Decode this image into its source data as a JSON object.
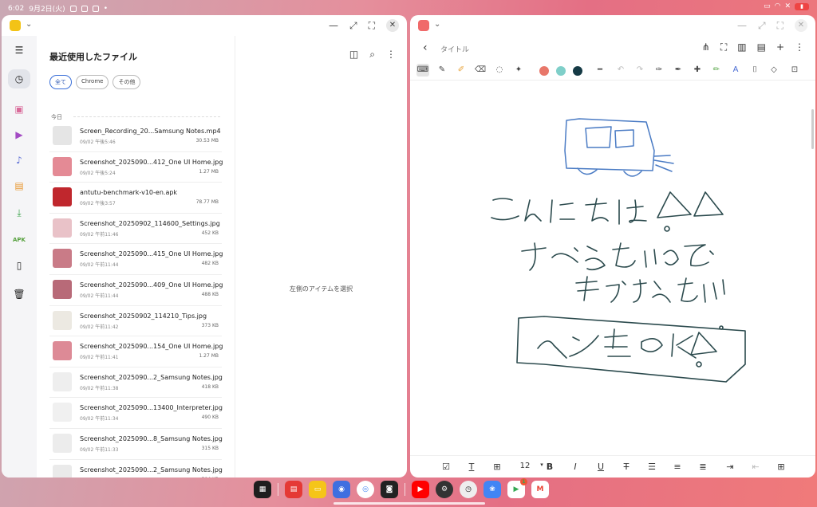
{
  "status_bar": {
    "time": "6:02",
    "date": "9月2日(火)"
  },
  "files_app": {
    "title": "最近使用したファイル",
    "filters": [
      "全て",
      "Chrome",
      "その他"
    ],
    "section": "今日",
    "empty_message": "左側のアイテムを選択",
    "rail_apk_label": "APK",
    "files": [
      {
        "name": "Screen_Recording_20...Samsung Notes.mp4",
        "date": "09/02 午後5:46",
        "size": "30.53 MB",
        "thumb": "#e5e5e5"
      },
      {
        "name": "Screenshot_2025090...412_One UI Home.jpg",
        "date": "09/02 午後5:24",
        "size": "1.27 MB",
        "thumb": "#e48a95"
      },
      {
        "name": "antutu-benchmark-v10-en.apk",
        "date": "09/02 午後3:57",
        "size": "78.77 MB",
        "thumb": "#c0272d"
      },
      {
        "name": "Screenshot_20250902_114600_Settings.jpg",
        "date": "09/02 午前11:46",
        "size": "452 KB",
        "thumb": "#e9c2c8"
      },
      {
        "name": "Screenshot_2025090...415_One UI Home.jpg",
        "date": "09/02 午前11:44",
        "size": "482 KB",
        "thumb": "#c97b87"
      },
      {
        "name": "Screenshot_2025090...409_One UI Home.jpg",
        "date": "09/02 午前11:44",
        "size": "488 KB",
        "thumb": "#b86a78"
      },
      {
        "name": "Screenshot_20250902_114210_Tips.jpg",
        "date": "09/02 午前11:42",
        "size": "373 KB",
        "thumb": "#ece9e2"
      },
      {
        "name": "Screenshot_2025090...154_One UI Home.jpg",
        "date": "09/02 午前11:41",
        "size": "1.27 MB",
        "thumb": "#dd8a96"
      },
      {
        "name": "Screenshot_2025090...2_Samsung Notes.jpg",
        "date": "09/02 午前11:38",
        "size": "418 KB",
        "thumb": "#eeeeee"
      },
      {
        "name": "Screenshot_2025090...13400_Interpreter.jpg",
        "date": "09/02 午前11:34",
        "size": "490 KB",
        "thumb": "#f0f0f0"
      },
      {
        "name": "Screenshot_2025090...8_Samsung Notes.jpg",
        "date": "09/02 午前11:33",
        "size": "315 KB",
        "thumb": "#ececec"
      },
      {
        "name": "Screenshot_2025090...2_Samsung Notes.jpg",
        "date": "09/02 午前11:33",
        "size": "504 KB",
        "thumb": "#eaeaea"
      }
    ]
  },
  "notes_app": {
    "title": "タイトル",
    "font_size": "12",
    "colors": {
      "pen_red": "#e8776a",
      "pen_teal": "#7fcfc9",
      "pen_dark": "#153a45",
      "ink": "#2b4a4d",
      "car": "#4a7bc4"
    }
  },
  "dock": {
    "play_badge": "1"
  }
}
